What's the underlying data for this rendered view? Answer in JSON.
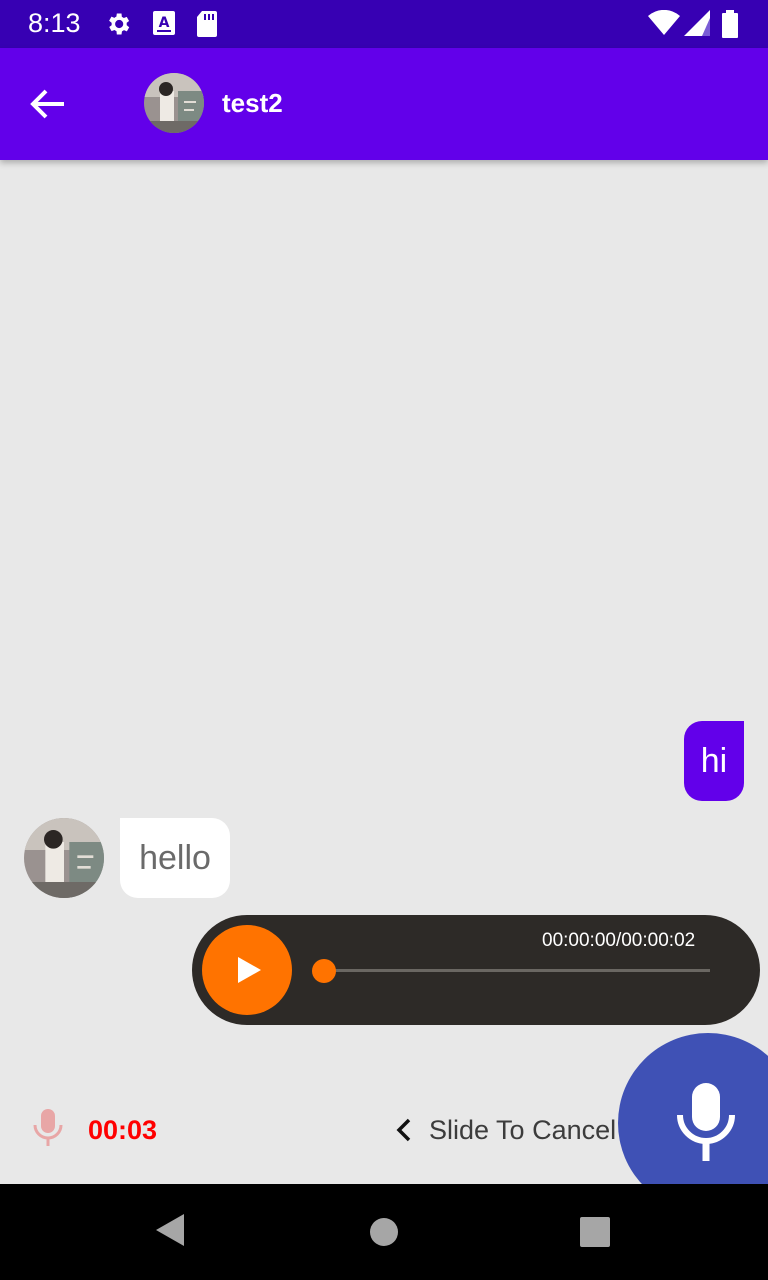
{
  "status_bar": {
    "time": "8:13",
    "icons": [
      "settings-icon",
      "keyboard-a-icon",
      "sd-card-icon",
      "wifi-icon",
      "signal-icon",
      "battery-icon"
    ]
  },
  "header": {
    "back_icon": "arrow-back-icon",
    "contact_name": "test2"
  },
  "messages": [
    {
      "direction": "outgoing",
      "text": "hi"
    },
    {
      "direction": "incoming",
      "text": "hello"
    }
  ],
  "audio_message": {
    "time": "00:00:00/00:00:02",
    "progress": 0
  },
  "recording": {
    "timer": "00:03",
    "slide_hint": "Slide To Cancel"
  },
  "colors": {
    "status_bar": "#3700b3",
    "app_bar": "#6200ea",
    "outgoing_bubble": "#6200ea",
    "audio_accent": "#ff7300",
    "audio_bg": "#2d2a27",
    "mic_fab": "#3f51b5",
    "timer": "#ff0000"
  },
  "nav_bar": {
    "buttons": [
      "back-nav-icon",
      "home-nav-icon",
      "recents-nav-icon"
    ]
  }
}
